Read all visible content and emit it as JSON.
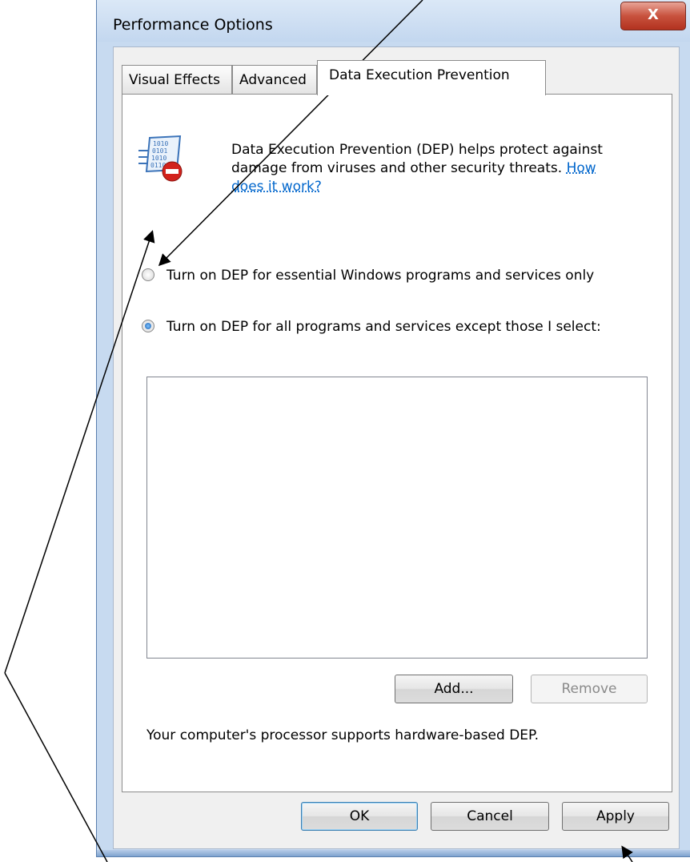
{
  "window": {
    "title": "Performance Options",
    "close_label": "X"
  },
  "tabs": [
    {
      "label": "Visual Effects",
      "active": false
    },
    {
      "label": "Advanced",
      "active": false
    },
    {
      "label": "Data Execution Prevention",
      "active": true
    }
  ],
  "dep": {
    "description": "Data Execution Prevention (DEP) helps protect against damage from viruses and other security threats.",
    "link": "How does it work?",
    "option_essential": "Turn on DEP for essential Windows programs and services only",
    "option_all": "Turn on DEP for all programs and services except those I select:",
    "selected_option": "all",
    "add_label": "Add...",
    "remove_label": "Remove",
    "status": "Your computer's processor supports hardware-based DEP."
  },
  "footer": {
    "ok_label": "OK",
    "cancel_label": "Cancel",
    "apply_label": "Apply"
  },
  "colors": {
    "frame": "#c7daf0",
    "close": "#c8523e",
    "link": "#0066cc"
  }
}
